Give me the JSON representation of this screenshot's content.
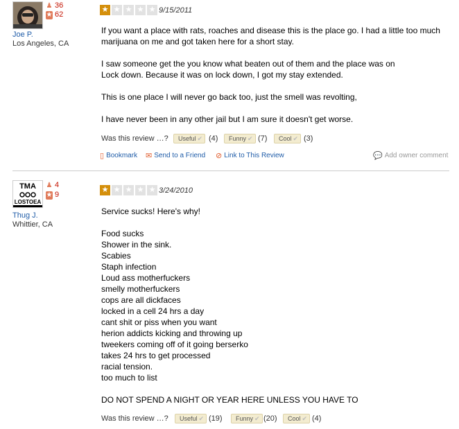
{
  "reviews": [
    {
      "user": {
        "name": "Joe P.",
        "location": "Los Angeles, CA",
        "friends": "36",
        "review_count": "62"
      },
      "rating": 1,
      "date": "9/15/2011",
      "lines": [
        "If you want a place with rats, roaches and disease this is the place go.  I had a little too much",
        "marijuana on me and got taken here for a short stay.",
        "",
        "I saw someone get the you know what beaten out of them and the place was on",
        "Lock down. Because it was on lock down, I got my stay extended.",
        "",
        "This is one place I will never go back too, just the smell was revolting,",
        "",
        "I have never been in any other jail but I am sure it doesn't get worse."
      ],
      "votes": {
        "question": "Was this review …?",
        "useful_label": "Useful",
        "useful_count": "(4)",
        "funny_label": "Funny",
        "funny_count": "(7)",
        "cool_label": "Cool",
        "cool_count": "(3)"
      },
      "actions": {
        "bookmark": "Bookmark",
        "send": "Send to a Friend",
        "link": "Link to This Review",
        "owner_comment": "Add owner comment"
      }
    },
    {
      "user": {
        "name": "Thug J.",
        "location": "Whittier, CA",
        "friends": "4",
        "review_count": "9",
        "avatar_text_top": "TMA",
        "avatar_text_bottom": "LOSTOEA"
      },
      "rating": 1,
      "date": "3/24/2010",
      "lines": [
        "Service sucks! Here's why!",
        "",
        "Food sucks",
        "Shower in the sink.",
        "Scabies",
        "Staph infection",
        "Loud ass motherfuckers",
        "smelly motherfuckers",
        "cops are all dickfaces",
        "locked in a cell 24 hrs a day",
        "cant shit or piss when you want",
        "herion addicts kicking and throwing up",
        "tweekers coming off of it going berserko",
        "takes 24 hrs to get processed",
        "racial tension.",
        "too much to list",
        "",
        "DO NOT SPEND A NIGHT OR YEAR HERE UNLESS YOU HAVE TO"
      ],
      "votes": {
        "question": "Was this review …?",
        "useful_label": "Useful",
        "useful_count": "(19)",
        "funny_label": "Funny",
        "funny_count": "(20)",
        "cool_label": "Cool",
        "cool_count": "(4)"
      }
    }
  ],
  "colors": {
    "star_on": "#d48f0b",
    "star_off": "#e2e2e2",
    "link": "#1f5ca8",
    "stat": "#c41200"
  },
  "icons": {
    "friends": "people-icon",
    "reviews": "star-badge-icon",
    "bookmark": "bookmark-icon",
    "send": "envelope-icon",
    "link": "link-icon",
    "owner_comment": "speech-bubble-icon",
    "vote_check": "checkmark-icon"
  }
}
